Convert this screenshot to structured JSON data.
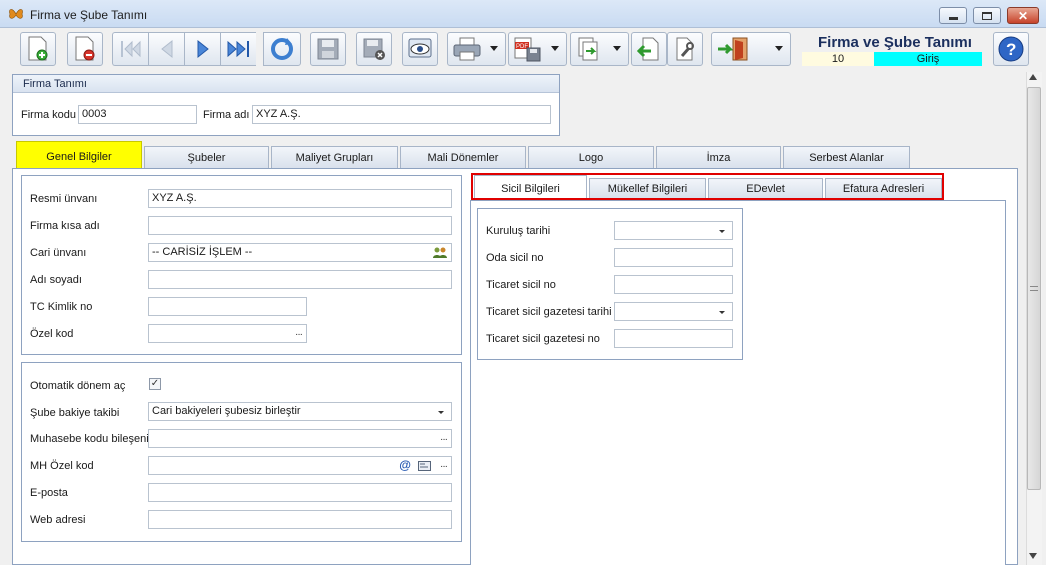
{
  "window": {
    "title": "Firma ve Şube Tanımı"
  },
  "toolbar": {
    "buttons": [
      {
        "name": "new-record-icon"
      },
      {
        "name": "delete-record-icon"
      },
      {
        "name": "first-record-icon"
      },
      {
        "name": "previous-record-icon"
      },
      {
        "name": "next-record-icon"
      },
      {
        "name": "last-record-icon"
      },
      {
        "name": "refresh-icon"
      },
      {
        "name": "save-icon"
      },
      {
        "name": "cancel-save-icon"
      },
      {
        "name": "preview-icon"
      },
      {
        "name": "print-icon"
      },
      {
        "name": "pdf-export-icon"
      },
      {
        "name": "export-icon"
      },
      {
        "name": "import-icon"
      },
      {
        "name": "settings-icon"
      },
      {
        "name": "exit-door-icon"
      },
      {
        "name": "help-icon"
      }
    ]
  },
  "header": {
    "title": "Firma ve Şube Tanımı",
    "period": "10",
    "status": "Giriş",
    "status_color": "#00ffff"
  },
  "firm": {
    "group_title": "Firma Tanımı",
    "code_label": "Firma kodu",
    "code_value": "0003",
    "name_label": "Firma adı",
    "name_value": "XYZ A.Ş."
  },
  "tabs": [
    {
      "label": "Genel Bilgiler",
      "active": true
    },
    {
      "label": "Şubeler"
    },
    {
      "label": "Maliyet Grupları"
    },
    {
      "label": "Mali Dönemler"
    },
    {
      "label": "Logo"
    },
    {
      "label": "İmza"
    },
    {
      "label": "Serbest Alanlar"
    }
  ],
  "general": {
    "official_title_label": "Resmi ünvanı",
    "official_title_value": "XYZ A.Ş.",
    "short_name_label": "Firma kısa adı",
    "short_name_value": "",
    "account_title_label": "Cari ünvanı",
    "account_title_value": "-- CARİSİZ İŞLEM --",
    "full_name_label": "Adı soyadı",
    "full_name_value": "",
    "tc_no_label": "TC Kimlik no",
    "tc_no_value": "",
    "special_code_label": "Özel kod",
    "special_code_value": ""
  },
  "settings": {
    "auto_period_label": "Otomatik dönem aç",
    "auto_period_checked": true,
    "branch_balance_label": "Şube bakiye takibi",
    "branch_balance_value": "Cari bakiyeleri şubesiz birleştir",
    "accounting_code_label": "Muhasebe kodu bileşeni",
    "accounting_code_value": "",
    "mh_special_code_label": "MH Özel kod",
    "mh_special_code_value": "",
    "email_label": "E-posta",
    "email_value": "",
    "website_label": "Web adresi",
    "website_value": ""
  },
  "inner_tabs": [
    {
      "label": "Sicil Bilgileri",
      "active": true
    },
    {
      "label": "Mükellef Bilgileri"
    },
    {
      "label": "EDevlet"
    },
    {
      "label": "Efatura Adresleri"
    }
  ],
  "registry": {
    "founded_date_label": "Kuruluş tarihi",
    "founded_date_value": "",
    "chamber_no_label": "Oda sicil no",
    "chamber_no_value": "",
    "trade_no_label": "Ticaret sicil no",
    "trade_no_value": "",
    "gazette_date_label": "Ticaret sicil gazetesi tarihi",
    "gazette_date_value": "",
    "gazette_no_label": "Ticaret sicil gazetesi no",
    "gazette_no_value": ""
  },
  "colors": {
    "active_tab": "#ffff00",
    "highlight_border": "#e00000",
    "header_title": "#1b2f5e"
  }
}
